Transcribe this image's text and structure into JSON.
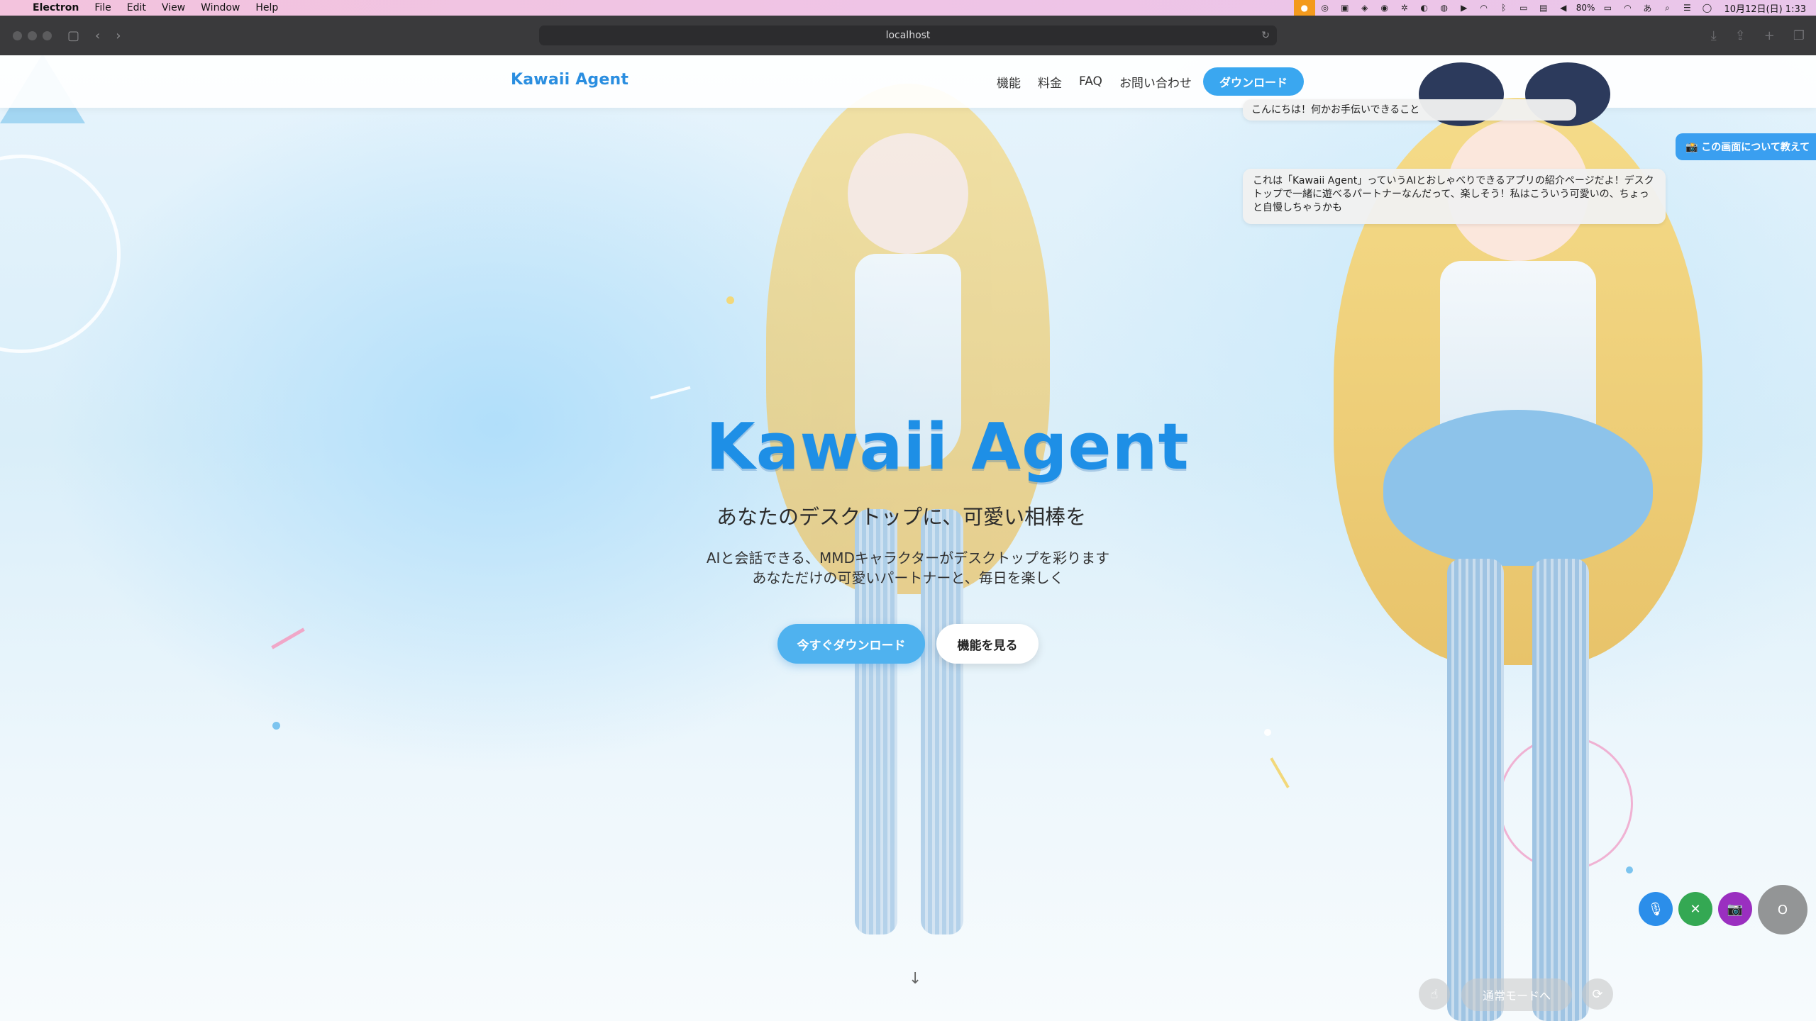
{
  "menubar": {
    "app_name": "Electron",
    "items": [
      "File",
      "Edit",
      "View",
      "Window",
      "Help"
    ],
    "battery": "80%",
    "ime": "あ",
    "clock": "10月12日(日) 1:33"
  },
  "browser": {
    "url": "localhost"
  },
  "site": {
    "logo": "Kawaii Agent",
    "nav": [
      "機能",
      "料金",
      "FAQ",
      "お問い合わせ"
    ],
    "nav_download": "ダウンロード"
  },
  "hero": {
    "title": "Kawaii Agent",
    "subtitle": "あなたのデスクトップに、可愛い相棒を",
    "desc_line1": "AIと会話できる、MMDキャラクターがデスクトップを彩ります",
    "desc_line2": "あなただけの可愛いパートナーと、毎日を楽しく",
    "primary_cta": "今すぐダウンロード",
    "secondary_cta": "機能を見る",
    "scroll_arrow": "↓"
  },
  "overlay": {
    "bubble1": "こんにちは！何かお手伝いできること",
    "bubble2": "これは「Kawaii Agent」っていうAIとおしゃべりできるアプリの紹介ページだよ！デスクトップで一緒に遊べるパートナーなんだって、楽しそう！私はこういう可愛いの、ちょっと自慢しちゃうかも",
    "ask_screen": "📸 この画面について教えて",
    "mode_button": "通常モードへ",
    "status_label": "O"
  },
  "colors": {
    "brand": "#1e8fe6",
    "primary_button": "#4fb2ef",
    "mic": "#2b8eea",
    "close": "#34a853",
    "camera": "#9a2fc0"
  }
}
